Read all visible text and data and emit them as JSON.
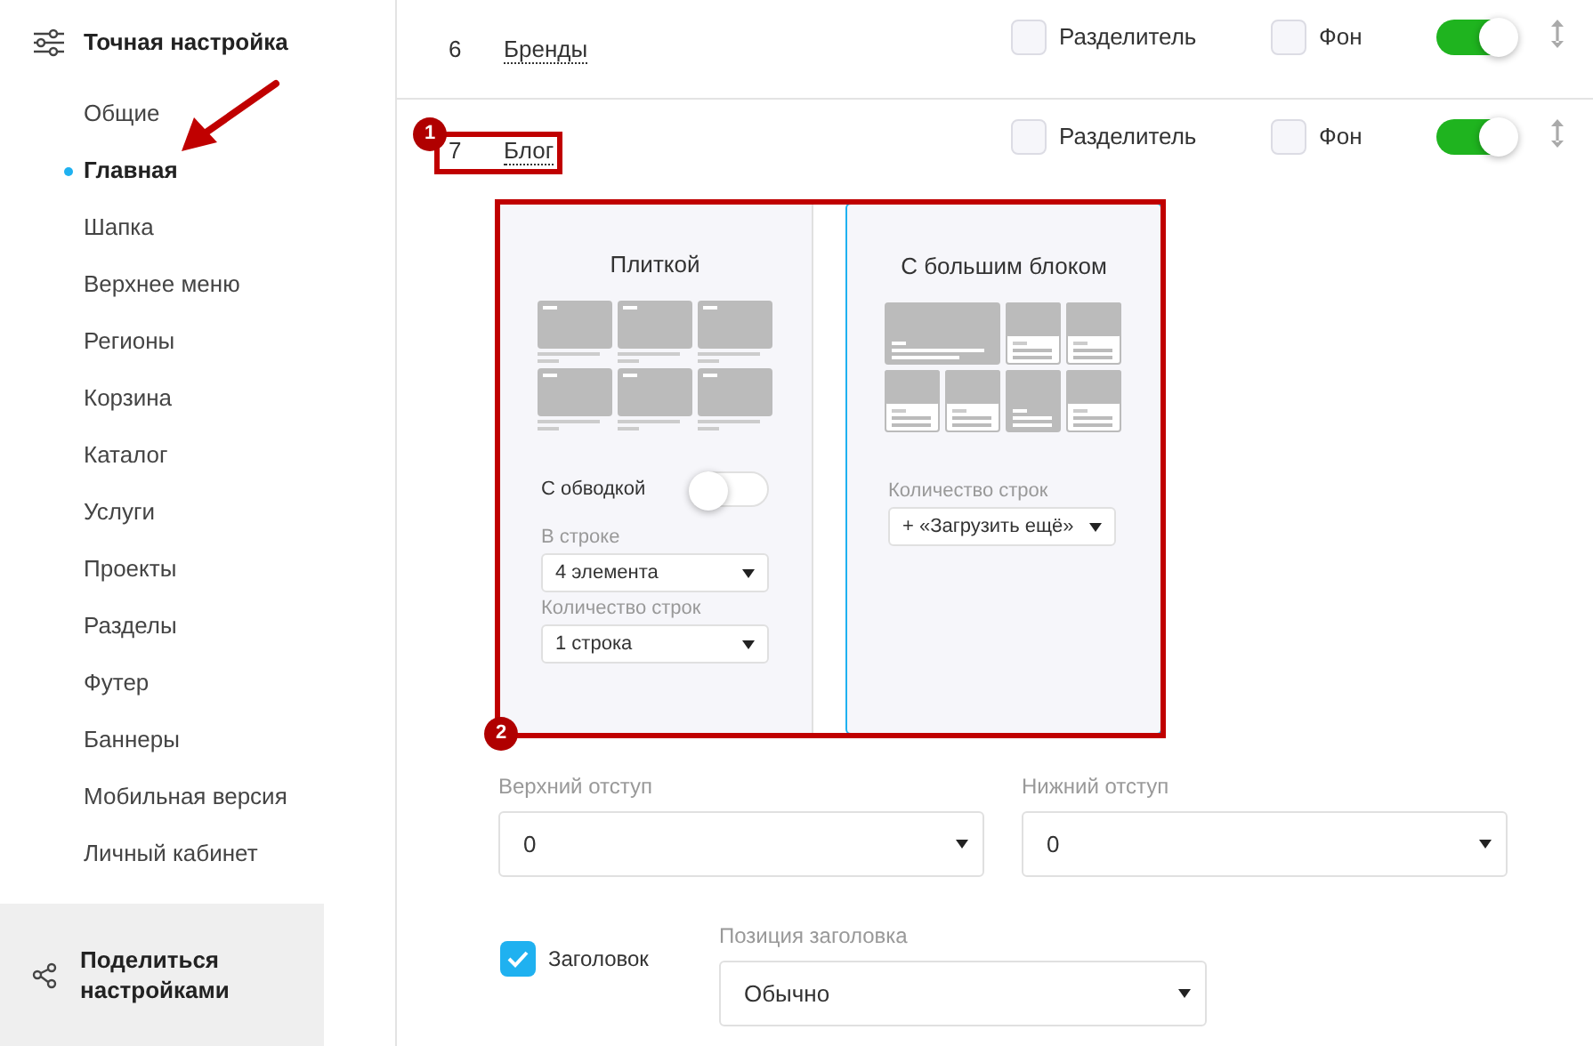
{
  "sidebar": {
    "header": "Точная настройка",
    "items": [
      {
        "label": "Общие",
        "selected": false
      },
      {
        "label": "Главная",
        "selected": true
      },
      {
        "label": "Шапка",
        "selected": false
      },
      {
        "label": "Верхнее меню",
        "selected": false
      },
      {
        "label": "Регионы",
        "selected": false
      },
      {
        "label": "Корзина",
        "selected": false
      },
      {
        "label": "Каталог",
        "selected": false
      },
      {
        "label": "Услуги",
        "selected": false
      },
      {
        "label": "Проекты",
        "selected": false
      },
      {
        "label": "Разделы",
        "selected": false
      },
      {
        "label": "Футер",
        "selected": false
      },
      {
        "label": "Баннеры",
        "selected": false
      },
      {
        "label": "Мобильная версия",
        "selected": false
      },
      {
        "label": "Личный кабинет",
        "selected": false
      }
    ],
    "share_button": "Поделиться настройками"
  },
  "blocks": [
    {
      "number": "6",
      "name": "Бренды",
      "divider": {
        "label": "Разделитель",
        "checked": false
      },
      "background": {
        "label": "Фон",
        "checked": false
      },
      "on": true
    },
    {
      "number": "7",
      "name": "Блог",
      "divider": {
        "label": "Разделитель",
        "checked": false
      },
      "background": {
        "label": "Фон",
        "checked": false
      },
      "on": true
    }
  ],
  "view_options": [
    {
      "kind": "tiles",
      "title": "Плиткой",
      "selected": false,
      "outline_toggle": {
        "label": "С обводкой",
        "on": false
      },
      "fields": [
        {
          "label": "В строке",
          "value": "4 элемента"
        },
        {
          "label": "Количество строк",
          "value": "1 строка"
        }
      ]
    },
    {
      "kind": "big",
      "title": "С большим блоком",
      "selected": true,
      "fields": [
        {
          "label": "Количество строк",
          "value": "+ «Загрузить ещё»"
        }
      ]
    }
  ],
  "spacing": [
    {
      "label": "Верхний отступ",
      "value": "0"
    },
    {
      "label": "Нижний отступ",
      "value": "0"
    }
  ],
  "heading": {
    "label": "Заголовок",
    "checked": true
  },
  "heading_position": {
    "label": "Позиция заголовка",
    "value": "Обычно"
  },
  "annotations": [
    {
      "number": "1"
    },
    {
      "number": "2"
    }
  ]
}
